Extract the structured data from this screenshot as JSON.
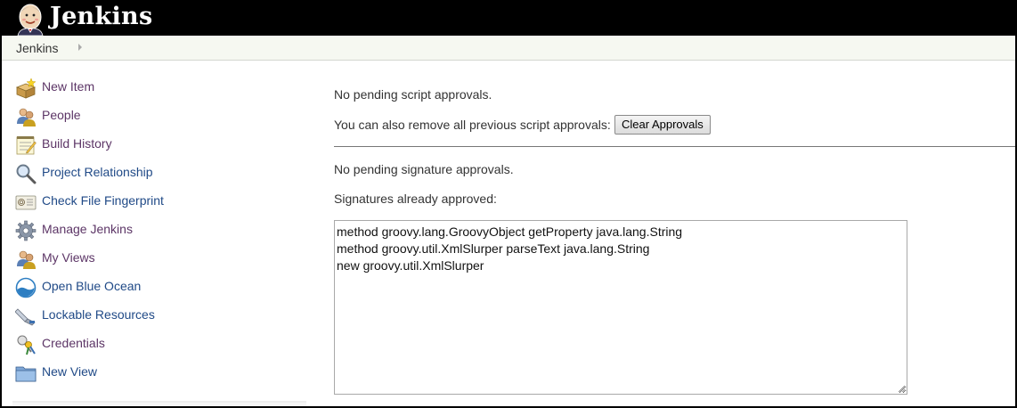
{
  "header": {
    "brand": "Jenkins",
    "logo_icon": "jenkins-butler-logo"
  },
  "breadcrumb": {
    "items": [
      "Jenkins"
    ]
  },
  "sidebar": {
    "items": [
      {
        "label": "New Item",
        "icon": "new-item-icon",
        "visited": true
      },
      {
        "label": "People",
        "icon": "people-icon",
        "visited": true
      },
      {
        "label": "Build History",
        "icon": "notepad-icon",
        "visited": true
      },
      {
        "label": "Project Relationship",
        "icon": "search-icon",
        "visited": false
      },
      {
        "label": "Check File Fingerprint",
        "icon": "fingerprint-icon",
        "visited": false
      },
      {
        "label": "Manage Jenkins",
        "icon": "gear-icon",
        "visited": true
      },
      {
        "label": "My Views",
        "icon": "user-icon",
        "visited": true
      },
      {
        "label": "Open Blue Ocean",
        "icon": "blue-ocean-icon",
        "visited": false
      },
      {
        "label": "Lockable Resources",
        "icon": "lockable-resources-icon",
        "visited": false
      },
      {
        "label": "Credentials",
        "icon": "credentials-icon",
        "visited": true
      },
      {
        "label": "New View",
        "icon": "folder-icon",
        "visited": false
      }
    ]
  },
  "main": {
    "no_script_approvals": "No pending script approvals.",
    "remove_previous": "You can also remove all previous script approvals:",
    "clear_button": "Clear Approvals",
    "no_signature_approvals": "No pending signature approvals.",
    "signatures_approved": "Signatures already approved:",
    "approved_signatures": [
      "method groovy.lang.GroovyObject getProperty java.lang.String",
      "method groovy.util.XmlSlurper parseText java.lang.String",
      "new groovy.util.XmlSlurper"
    ]
  },
  "colors": {
    "link": "#204a87",
    "visited_link": "#5c3566",
    "header_bg": "#000000",
    "breadcrumb_bg": "#f6f8f1"
  }
}
